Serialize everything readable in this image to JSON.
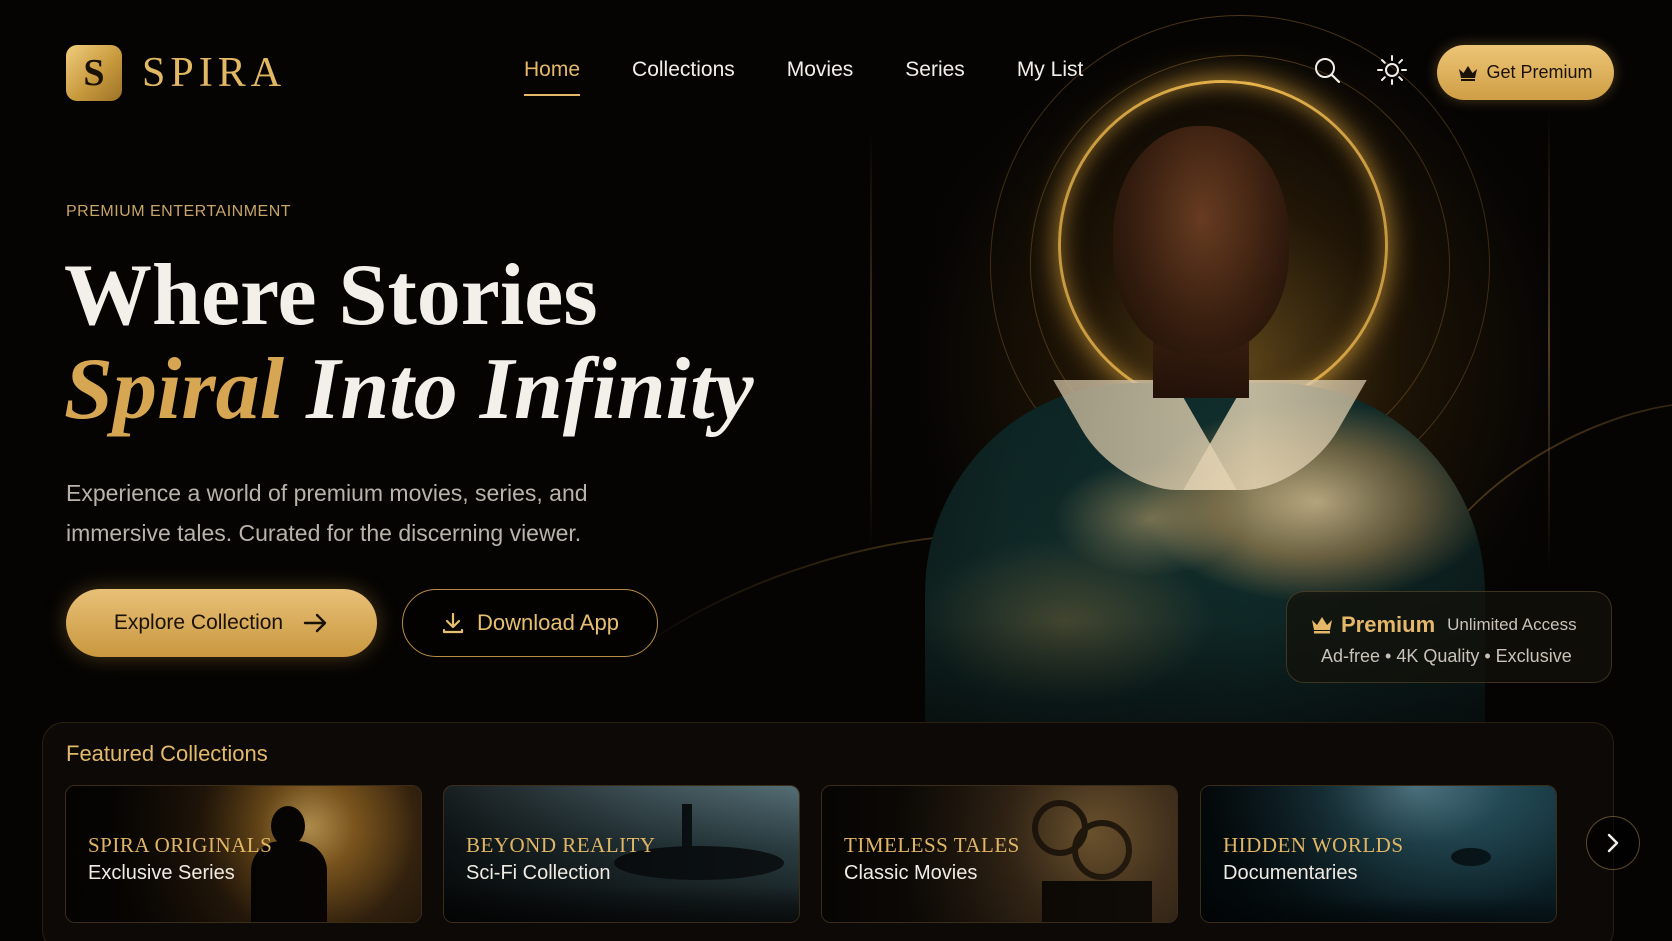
{
  "brand": {
    "mark": "S",
    "name": "SPIRA"
  },
  "nav": {
    "items": [
      {
        "label": "Home",
        "active": true
      },
      {
        "label": "Collections",
        "active": false
      },
      {
        "label": "Movies",
        "active": false
      },
      {
        "label": "Series",
        "active": false
      },
      {
        "label": "My List",
        "active": false
      }
    ]
  },
  "header": {
    "search_icon": "search-icon",
    "theme_icon": "sun-icon",
    "premium_button": {
      "label": "Get Premium",
      "icon": "crown-icon"
    }
  },
  "hero": {
    "eyebrow": "PREMIUM ENTERTAINMENT",
    "headline_line1": "Where Stories",
    "headline_gold": "Spiral",
    "headline_rest": "Into Infinity",
    "lead_line1": "Experience a world of premium movies, series, and",
    "lead_line2": "immersive tales. Curated for the discerning viewer.",
    "primary_button": {
      "label": "Explore Collection",
      "icon": "arrow-right-icon"
    },
    "secondary_button": {
      "label": "Download App",
      "icon": "download-icon"
    }
  },
  "premium_card": {
    "title": "Premium",
    "subtitle": "Unlimited Access",
    "features": "Ad-free • 4K Quality • Exclusive",
    "icon": "crown-icon"
  },
  "featured": {
    "title": "Featured Collections",
    "cards": [
      {
        "title": "SPIRA ORIGINALS",
        "subtitle": "Exclusive Series"
      },
      {
        "title": "BEYOND REALITY",
        "subtitle": "Sci-Fi Collection"
      },
      {
        "title": "TIMELESS TALES",
        "subtitle": "Classic Movies"
      },
      {
        "title": "HIDDEN WORLDS",
        "subtitle": "Documentaries"
      }
    ],
    "next_icon": "chevron-right-icon"
  },
  "colors": {
    "gold": "#d7a653",
    "gold_light": "#edc576",
    "background": "#050403",
    "text": "#f3f0ea"
  }
}
